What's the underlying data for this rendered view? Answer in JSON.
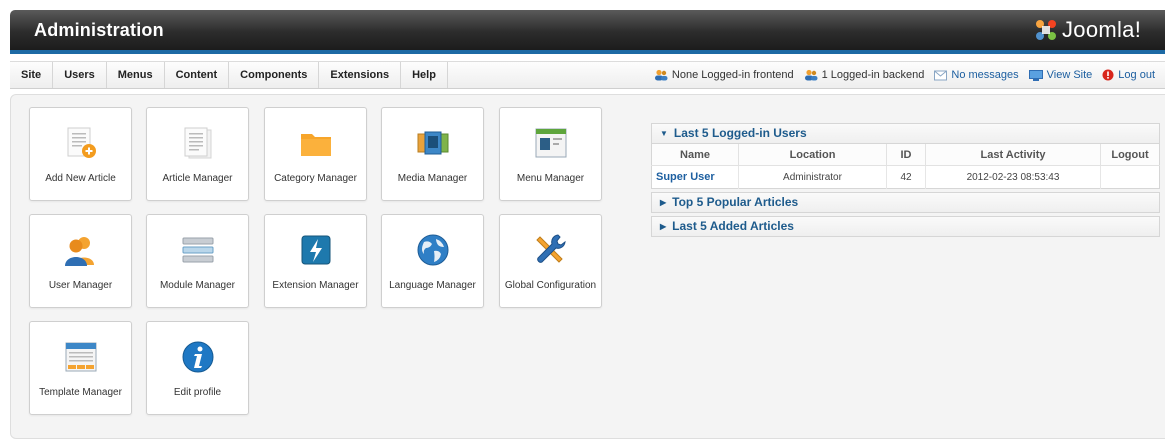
{
  "header": {
    "title": "Administration",
    "logo_text": "Joomla!"
  },
  "menu": {
    "items": [
      "Site",
      "Users",
      "Menus",
      "Content",
      "Components",
      "Extensions",
      "Help"
    ]
  },
  "status": {
    "frontend": "None Logged-in frontend",
    "backend": "1 Logged-in backend",
    "messages": "No messages",
    "view_site": "View Site",
    "logout": "Log out"
  },
  "quickicons": [
    {
      "label": "Add New Article",
      "icon": "add-article-icon"
    },
    {
      "label": "Article Manager",
      "icon": "article-manager-icon"
    },
    {
      "label": "Category Manager",
      "icon": "folder-icon"
    },
    {
      "label": "Media Manager",
      "icon": "media-icon"
    },
    {
      "label": "Menu Manager",
      "icon": "menu-manager-icon"
    },
    {
      "label": "User Manager",
      "icon": "user-icon"
    },
    {
      "label": "Module Manager",
      "icon": "module-icon"
    },
    {
      "label": "Extension Manager",
      "icon": "extension-icon"
    },
    {
      "label": "Language Manager",
      "icon": "globe-icon"
    },
    {
      "label": "Global Configuration",
      "icon": "tools-icon"
    },
    {
      "label": "Template Manager",
      "icon": "template-icon"
    },
    {
      "label": "Edit profile",
      "icon": "info-icon"
    }
  ],
  "modules": {
    "logged_users": {
      "title": "Last 5 Logged-in Users",
      "columns": [
        "Name",
        "Location",
        "ID",
        "Last Activity",
        "Logout"
      ],
      "rows": [
        {
          "name": "Super User",
          "location": "Administrator",
          "id": "42",
          "last_activity": "2012-02-23 08:53:43",
          "logout": ""
        }
      ]
    },
    "popular": {
      "title": "Top 5 Popular Articles"
    },
    "added": {
      "title": "Last 5 Added Articles"
    }
  },
  "colors": {
    "header_dark": "#2c2c2c",
    "accent_blue": "#1d6aa5",
    "link_blue": "#1d5fa0",
    "module_title": "#1e5b8c"
  }
}
